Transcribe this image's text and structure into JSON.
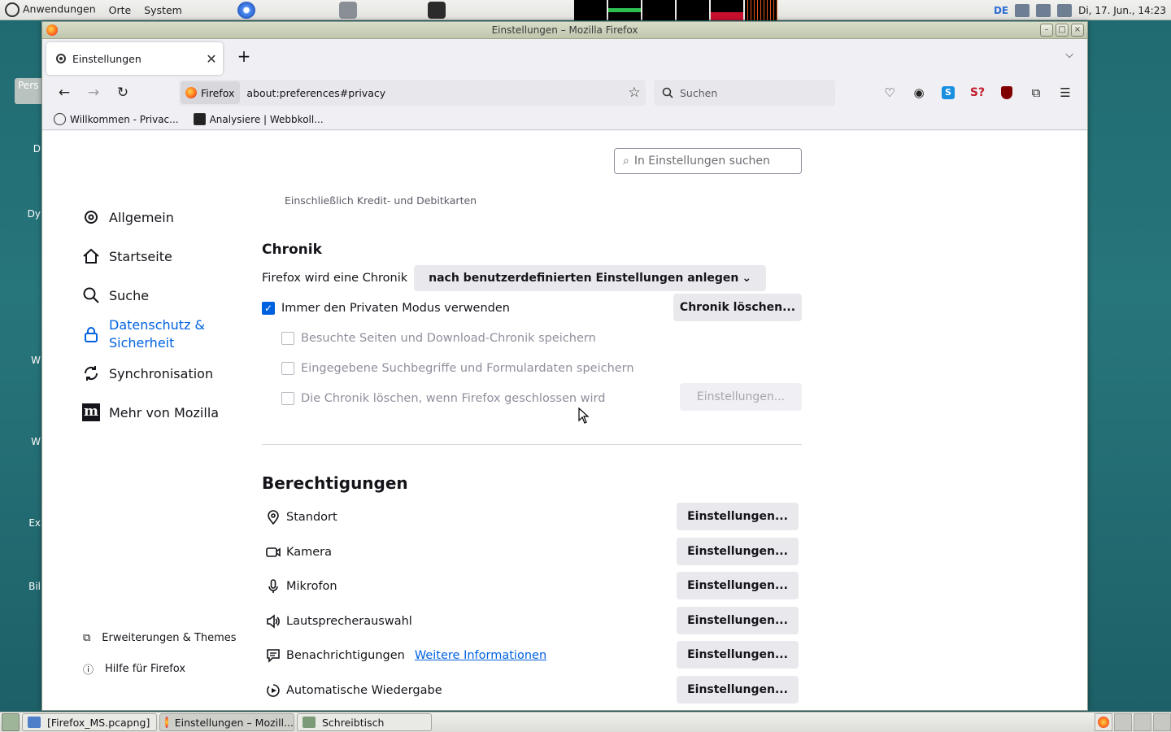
{
  "desktop": {
    "icons": [
      "Pers",
      "D",
      "Dy",
      "W",
      "W",
      "Ex",
      "Bil"
    ]
  },
  "top_panel": {
    "menu": [
      "Anwendungen",
      "Orte",
      "System"
    ],
    "keyboard_layout": "DE",
    "clock": "Di, 17. Jun., 14:23"
  },
  "window": {
    "title": "Einstellungen – Mozilla Firefox",
    "tab_title": "Einstellungen",
    "identity_label": "Firefox",
    "url": "about:preferences#privacy",
    "search_placeholder": "Suchen",
    "bookmarks": [
      "Willkommen - Privac...",
      "Analysiere | Webbkoll..."
    ]
  },
  "prefs": {
    "search_placeholder": "In Einstellungen suchen",
    "sidebar": [
      {
        "label": "Allgemein",
        "icon": "gear-icon"
      },
      {
        "label": "Startseite",
        "icon": "home-icon"
      },
      {
        "label": "Suche",
        "icon": "search-icon"
      },
      {
        "label": "Datenschutz & Sicherheit",
        "line1": "Datenschutz &",
        "line2": "Sicherheit",
        "icon": "lock-icon"
      },
      {
        "label": "Synchronisation",
        "icon": "sync-icon"
      },
      {
        "label": "Mehr von Mozilla",
        "icon": "mozilla-icon"
      }
    ],
    "sidebar_bottom": [
      "Erweiterungen & Themes",
      "Hilfe für Firefox"
    ],
    "cut_text": "Einschließlich Kredit- und Debitkarten",
    "history": {
      "heading": "Chronik",
      "label": "Firefox wird eine Chronik",
      "dropdown_value": "nach benutzerdefinierten Einstellungen anlegen",
      "clear_button": "Chronik löschen...",
      "settings_button": "Einstellungen...",
      "options": [
        {
          "label": "Immer den Privaten Modus verwenden",
          "checked": true,
          "disabled": false
        },
        {
          "label": "Besuchte Seiten und Download-Chronik speichern",
          "checked": false,
          "disabled": true
        },
        {
          "label": "Eingegebene Suchbegriffe und Formulardaten speichern",
          "checked": false,
          "disabled": true
        },
        {
          "label": "Die Chronik löschen, wenn Firefox geschlossen wird",
          "checked": false,
          "disabled": true
        }
      ]
    },
    "permissions": {
      "heading": "Berechtigungen",
      "button_label": "Einstellungen...",
      "link": "Weitere Informationen",
      "items": [
        "Standort",
        "Kamera",
        "Mikrofon",
        "Lautsprecherauswahl",
        "Benachrichtigungen",
        "Automatische Wiedergabe"
      ]
    }
  },
  "taskbar": {
    "tasks": [
      "[Firefox_MS.pcapng]",
      "Einstellungen – Mozill...",
      "Schreibtisch"
    ]
  },
  "colors": {
    "accent": "#0061e0",
    "desktop": "#2a6f77"
  }
}
